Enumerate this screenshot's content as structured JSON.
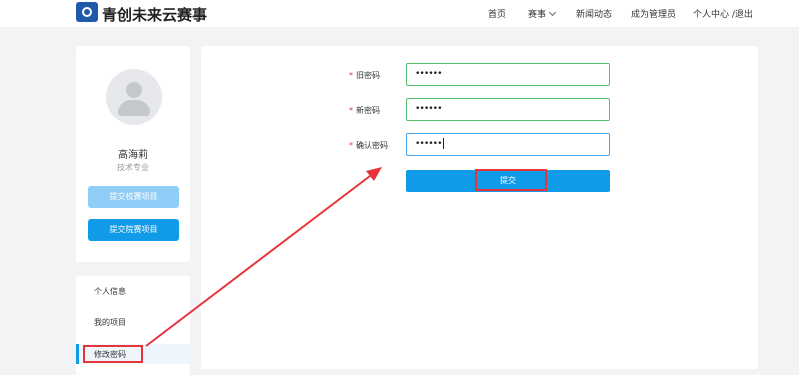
{
  "header": {
    "brand": "青创未来云赛事",
    "nav": {
      "home": "首页",
      "contest": "赛事",
      "news": "新闻动态",
      "become_admin": "成为管理员",
      "user_links": "个人中心 /退出"
    }
  },
  "profile": {
    "name": "高海莉",
    "major": "技术专业",
    "btn_school_project": "提交校赛项目",
    "btn_college_project": "提交院赛项目"
  },
  "menu": {
    "items": [
      "个人信息",
      "我的项目",
      "修改密码"
    ],
    "active_index": 2
  },
  "form": {
    "required_mark": "*",
    "old_password_label": "旧密码",
    "old_password_value": "••••••",
    "new_password_label": "新密码",
    "new_password_value": "••••••",
    "confirm_password_label": "确认密码",
    "confirm_password_value": "••••••",
    "submit_label": "提交"
  },
  "colors": {
    "primary": "#109be9",
    "primary_light": "#8fcdf6",
    "valid_border": "#53c26a",
    "annotation": "#e8333b"
  }
}
